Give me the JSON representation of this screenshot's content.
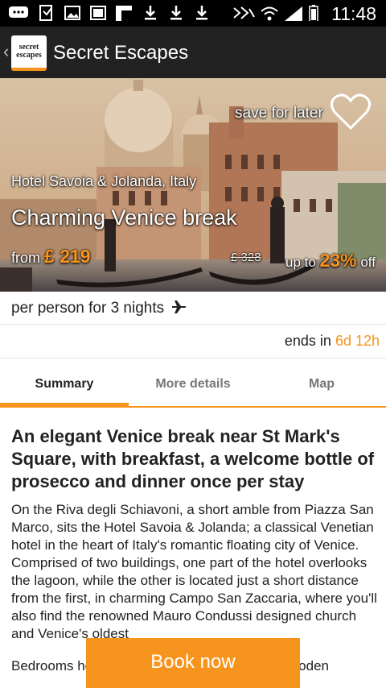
{
  "status_bar": {
    "time": "11:48"
  },
  "action_bar": {
    "back_glyph": "‹",
    "logo_line1": "secret",
    "logo_line2": "escapes",
    "title": "Secret Escapes"
  },
  "hero": {
    "save_label": "save for later",
    "hotel": "Hotel Savoia & Jolanda, Italy",
    "headline": "Charming Venice break",
    "from_label": "from",
    "price": "£ 219",
    "was_price": "£ 328",
    "upto_label": "up to",
    "discount": "23%",
    "off_label": "off"
  },
  "offer": {
    "per_person": "per person for 3 nights",
    "ends_label": "ends in",
    "ends_value": "6d 12h"
  },
  "tabs": [
    {
      "label": "Summary",
      "active": true
    },
    {
      "label": "More details",
      "active": false
    },
    {
      "label": "Map",
      "active": false
    }
  ],
  "content": {
    "heading": "An elegant Venice break near St Mark's Square, with breakfast, a welcome bottle of prosecco and dinner once per stay",
    "paragraph1": "On the Riva degli Schiavoni, a short amble from Piazza San Marco, sits the Hotel Savoia & Jolanda; a classical Venetian hotel in the heart of Italy's romantic floating city of Venice. Comprised of two buildings, one part of the hotel overlooks the lagoon, while the other is located just a short distance from the first, in charming Campo San Zaccaria, where you'll also find the renowned Mauro Condussi designed church and Venice's oldest",
    "paragraph2": "Bedrooms here are flamboyantly Italian with wooden"
  },
  "book_button": "Book now",
  "colors": {
    "accent": "#f7941d",
    "action_bar": "#222222",
    "status_bar": "#000000"
  }
}
